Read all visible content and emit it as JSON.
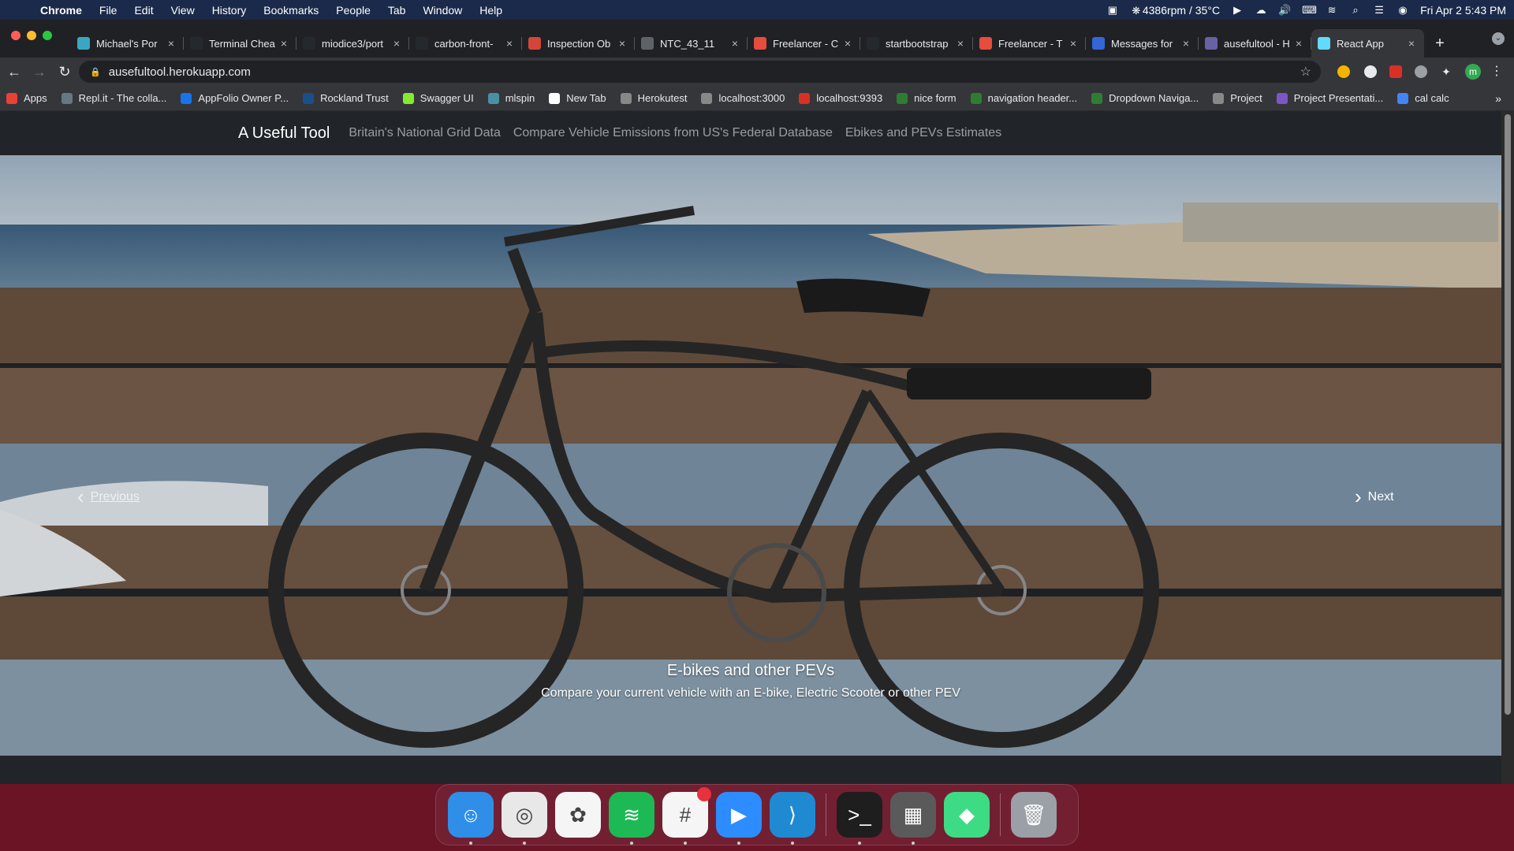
{
  "menubar": {
    "app": "Chrome",
    "items": [
      "File",
      "Edit",
      "View",
      "History",
      "Bookmarks",
      "People",
      "Tab",
      "Window",
      "Help"
    ],
    "status_fan": "4386rpm / 35°C",
    "datetime": "Fri Apr 2  5:43 PM"
  },
  "tabs": [
    {
      "title": "Michael's Por",
      "icon_color": "#3aa6c4"
    },
    {
      "title": "Terminal Chea",
      "icon_color": "#24292e"
    },
    {
      "title": "miodice3/port",
      "icon_color": "#24292e"
    },
    {
      "title": "carbon-front-",
      "icon_color": "#24292e"
    },
    {
      "title": "Inspection Ob",
      "icon_color": "#d44638"
    },
    {
      "title": "NTC_43_11",
      "icon_color": "#5f6368"
    },
    {
      "title": "Freelancer - C",
      "icon_color": "#e74c3c"
    },
    {
      "title": "startbootstrap",
      "icon_color": "#24292e"
    },
    {
      "title": "Freelancer - T",
      "icon_color": "#e74c3c"
    },
    {
      "title": "Messages for",
      "icon_color": "#3367d6"
    },
    {
      "title": "ausefultool - H",
      "icon_color": "#6762a6"
    },
    {
      "title": "React App",
      "icon_color": "#61dafb"
    }
  ],
  "url": "ausefultool.herokuapp.com",
  "bookmarks": [
    {
      "label": "Apps",
      "color": "#e94235"
    },
    {
      "label": "Repl.it - The colla...",
      "color": "#667881"
    },
    {
      "label": "AppFolio Owner P...",
      "color": "#1a73e8"
    },
    {
      "label": "Rockland Trust",
      "color": "#1b4f8a"
    },
    {
      "label": "Swagger UI",
      "color": "#85ea2d"
    },
    {
      "label": "mlspin",
      "color": "#4a90a4"
    },
    {
      "label": "New Tab",
      "color": "#ffffff"
    },
    {
      "label": "Herokutest",
      "color": "#888888"
    },
    {
      "label": "localhost:3000",
      "color": "#888888"
    },
    {
      "label": "localhost:9393",
      "color": "#d93025"
    },
    {
      "label": "nice form",
      "color": "#2e7d32"
    },
    {
      "label": "navigation header...",
      "color": "#2e7d32"
    },
    {
      "label": "Dropdown Naviga...",
      "color": "#2e7d32"
    },
    {
      "label": "Project",
      "color": "#888888"
    },
    {
      "label": "Project Presentati...",
      "color": "#7b57c6"
    },
    {
      "label": "cal calc",
      "color": "#4285f4"
    }
  ],
  "site": {
    "brand": "A Useful Tool",
    "nav": [
      "Britain's National Grid Data",
      "Compare Vehicle Emissions from US's Federal Database",
      "Ebikes and PEVs Estimates"
    ]
  },
  "carousel": {
    "prev_label": "Previous",
    "next_label": "Next",
    "caption_title": "E-bikes and other PEVs",
    "caption_text": "Compare your current vehicle with an E-bike, Electric Scooter or other PEV"
  },
  "dock": [
    {
      "name": "finder-icon",
      "color": "#2f8fe8"
    },
    {
      "name": "chrome-icon",
      "color": "#e8e8e8"
    },
    {
      "name": "photos-icon",
      "color": "#f5f5f5"
    },
    {
      "name": "spotify-icon",
      "color": "#1db954"
    },
    {
      "name": "slack-icon",
      "color": "#f5f5f5"
    },
    {
      "name": "zoom-icon",
      "color": "#2d8cff"
    },
    {
      "name": "vscode-icon",
      "color": "#1f8ad2"
    },
    {
      "name": "terminal-icon",
      "color": "#1e1e1e"
    },
    {
      "name": "calculator-icon",
      "color": "#5a5a5a"
    },
    {
      "name": "android-studio-icon",
      "color": "#3ddc84"
    },
    {
      "name": "trash-icon",
      "color": "#9aa0a6"
    }
  ]
}
